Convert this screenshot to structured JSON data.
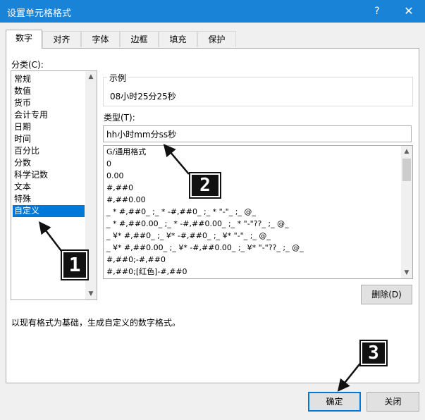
{
  "dialog": {
    "title": "设置单元格格式",
    "help_glyph": "?",
    "close_glyph": "✕"
  },
  "tabs": [
    "数字",
    "对齐",
    "字体",
    "边框",
    "填充",
    "保护"
  ],
  "category": {
    "label": "分类(C):",
    "items": [
      "常规",
      "数值",
      "货币",
      "会计专用",
      "日期",
      "时间",
      "百分比",
      "分数",
      "科学记数",
      "文本",
      "特殊",
      "自定义"
    ],
    "selected": "自定义"
  },
  "sample": {
    "label": "示例",
    "value": "08小时25分25秒"
  },
  "type": {
    "label": "类型(T):",
    "value": "hh小时mm分ss秒",
    "formats": [
      "G/通用格式",
      "0",
      "0.00",
      "#,##0",
      "#,##0.00",
      "_ * #,##0_ ;_ * -#,##0_ ;_ * \"-\"_ ;_ @_",
      "_ * #,##0.00_ ;_ * -#,##0.00_ ;_ * \"-\"??_ ;_ @_",
      "_ ¥* #,##0_ ;_ ¥* -#,##0_ ;_ ¥* \"-\"_ ;_ @_",
      "_ ¥* #,##0.00_ ;_ ¥* -#,##0.00_ ;_ ¥* \"-\"??_ ;_ @_",
      "#,##0;-#,##0",
      "#,##0;[红色]-#,##0"
    ]
  },
  "buttons": {
    "delete": "删除(D)",
    "ok": "确定",
    "close": "关闭"
  },
  "description": "以现有格式为基础，生成自定义的数字格式。",
  "callouts": [
    "1",
    "2",
    "3"
  ],
  "colors": {
    "titlebar": "#1883d7",
    "selection": "#0078d7"
  }
}
